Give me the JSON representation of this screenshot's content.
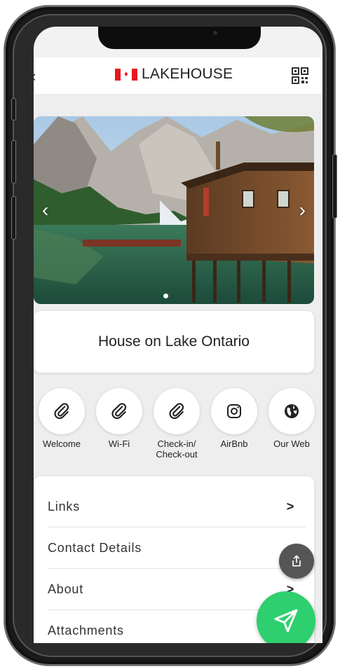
{
  "header": {
    "back_icon": "chevron-left-icon",
    "brand_name": "LAKEHOUSE",
    "qr_icon": "qr-code-icon"
  },
  "hero": {
    "prev_icon": "chevron-left-icon",
    "next_icon": "chevron-right-icon",
    "active_slide": 1,
    "slide_count": 2
  },
  "property": {
    "title": "House on Lake Ontario"
  },
  "actions": [
    {
      "label": "Welcome",
      "icon": "paperclip-icon"
    },
    {
      "label": "Wi-Fi",
      "icon": "paperclip-icon"
    },
    {
      "label": "Check-in/\nCheck-out",
      "icon": "paperclip-icon"
    },
    {
      "label": "AirBnb",
      "icon": "instagram-icon"
    },
    {
      "label": "Our Web",
      "icon": "globe-icon"
    }
  ],
  "menu": {
    "items": [
      {
        "label": "Links",
        "chevron": ">"
      },
      {
        "label": "Contact Details",
        "chevron": ""
      },
      {
        "label": "About",
        "chevron": ">"
      },
      {
        "label": "Attachments",
        "chevron": ""
      }
    ]
  },
  "fab": {
    "share_icon": "share-icon",
    "send_icon": "send-icon"
  },
  "colors": {
    "accent_green": "#2ecf6e",
    "flag_red": "#e8181e",
    "share_button": "#555555"
  }
}
